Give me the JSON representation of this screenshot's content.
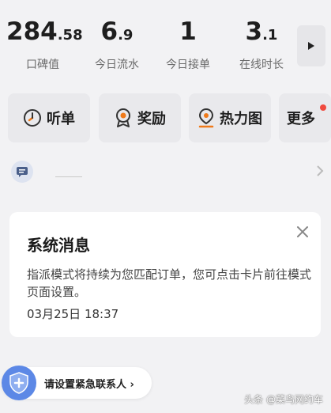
{
  "stats": [
    {
      "int": "284",
      "dec": ".58",
      "label": "口碑值"
    },
    {
      "int": "6",
      "dec": ".9",
      "label": "今日流水"
    },
    {
      "int": "1",
      "dec": "",
      "label": "今日接单"
    },
    {
      "int": "3",
      "dec": ".1",
      "label": "在线时长"
    }
  ],
  "quick": [
    {
      "label": "听单",
      "icon": "clock-icon"
    },
    {
      "label": "奖励",
      "icon": "medal-icon"
    },
    {
      "label": "热力图",
      "icon": "location-pin-icon"
    },
    {
      "label": "更多",
      "icon": ""
    }
  ],
  "message": {
    "title": "系统消息",
    "body": "指派模式将持续为您匹配订单，您可点击卡片前往模式页面设置。",
    "time": "03月25日 18:37"
  },
  "emergency": {
    "label": "请设置紧急联系人"
  },
  "watermark": "头条 @菜鸟网约车",
  "colors": {
    "accent_orange": "#ef7a1a",
    "accent_blue": "#5c88e6",
    "red_dot": "#f04a3e"
  }
}
